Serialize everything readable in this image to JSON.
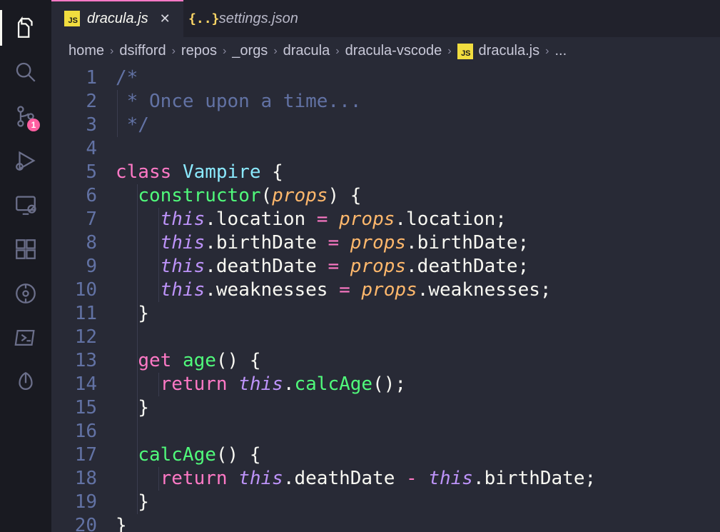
{
  "activityBar": {
    "items": [
      {
        "id": "explorer",
        "name": "explorer-icon",
        "active": true
      },
      {
        "id": "search",
        "name": "search-icon"
      },
      {
        "id": "scm",
        "name": "source-control-icon",
        "badge": "1"
      },
      {
        "id": "run",
        "name": "run-debug-icon"
      },
      {
        "id": "remote",
        "name": "remote-explorer-icon"
      },
      {
        "id": "ext",
        "name": "extensions-icon"
      },
      {
        "id": "gitlens",
        "name": "gitlens-icon"
      },
      {
        "id": "console",
        "name": "powershell-icon"
      },
      {
        "id": "cloud",
        "name": "cloud-icon"
      }
    ]
  },
  "tabs": [
    {
      "label": "dracula.js",
      "iconType": "js",
      "active": true,
      "dirty": false,
      "closeable": true
    },
    {
      "label": "settings.json",
      "iconType": "json",
      "active": false
    }
  ],
  "breadcrumbs": {
    "parts": [
      "home",
      "dsifford",
      "repos",
      "_orgs",
      "dracula",
      "dracula-vscode"
    ],
    "fileIcon": "js",
    "fileName": "dracula.js",
    "trailing": "..."
  },
  "code": {
    "language": "javascript",
    "lines": [
      [
        [
          "comment",
          "/*"
        ]
      ],
      [
        [
          "comment",
          " * Once upon a time..."
        ]
      ],
      [
        [
          "comment",
          " */"
        ]
      ],
      [],
      [
        [
          "keyword",
          "class"
        ],
        [
          "punct",
          " "
        ],
        [
          "class",
          "Vampire"
        ],
        [
          "punct",
          " {"
        ]
      ],
      [
        [
          "punct",
          "  "
        ],
        [
          "func",
          "constructor"
        ],
        [
          "punct",
          "("
        ],
        [
          "param",
          "props"
        ],
        [
          "punct",
          ") {"
        ]
      ],
      [
        [
          "punct",
          "    "
        ],
        [
          "this",
          "this"
        ],
        [
          "punct",
          ".location "
        ],
        [
          "op",
          "="
        ],
        [
          "punct",
          " "
        ],
        [
          "propsref",
          "props"
        ],
        [
          "punct",
          ".location;"
        ]
      ],
      [
        [
          "punct",
          "    "
        ],
        [
          "this",
          "this"
        ],
        [
          "punct",
          ".birthDate "
        ],
        [
          "op",
          "="
        ],
        [
          "punct",
          " "
        ],
        [
          "propsref",
          "props"
        ],
        [
          "punct",
          ".birthDate;"
        ]
      ],
      [
        [
          "punct",
          "    "
        ],
        [
          "this",
          "this"
        ],
        [
          "punct",
          ".deathDate "
        ],
        [
          "op",
          "="
        ],
        [
          "punct",
          " "
        ],
        [
          "propsref",
          "props"
        ],
        [
          "punct",
          ".deathDate;"
        ]
      ],
      [
        [
          "punct",
          "    "
        ],
        [
          "this",
          "this"
        ],
        [
          "punct",
          ".weaknesses "
        ],
        [
          "op",
          "="
        ],
        [
          "punct",
          " "
        ],
        [
          "propsref",
          "props"
        ],
        [
          "punct",
          ".weaknesses;"
        ]
      ],
      [
        [
          "punct",
          "  }"
        ]
      ],
      [],
      [
        [
          "punct",
          "  "
        ],
        [
          "keyword",
          "get"
        ],
        [
          "punct",
          " "
        ],
        [
          "func",
          "age"
        ],
        [
          "punct",
          "() {"
        ]
      ],
      [
        [
          "punct",
          "    "
        ],
        [
          "keyword",
          "return"
        ],
        [
          "punct",
          " "
        ],
        [
          "this",
          "this"
        ],
        [
          "punct",
          "."
        ],
        [
          "func",
          "calcAge"
        ],
        [
          "punct",
          "();"
        ]
      ],
      [
        [
          "punct",
          "  }"
        ]
      ],
      [],
      [
        [
          "punct",
          "  "
        ],
        [
          "func",
          "calcAge"
        ],
        [
          "punct",
          "() {"
        ]
      ],
      [
        [
          "punct",
          "    "
        ],
        [
          "keyword",
          "return"
        ],
        [
          "punct",
          " "
        ],
        [
          "this",
          "this"
        ],
        [
          "punct",
          ".deathDate "
        ],
        [
          "op",
          "-"
        ],
        [
          "punct",
          " "
        ],
        [
          "this",
          "this"
        ],
        [
          "punct",
          ".birthDate;"
        ]
      ],
      [
        [
          "punct",
          "  }"
        ]
      ],
      [
        [
          "punct",
          "}"
        ]
      ]
    ]
  }
}
